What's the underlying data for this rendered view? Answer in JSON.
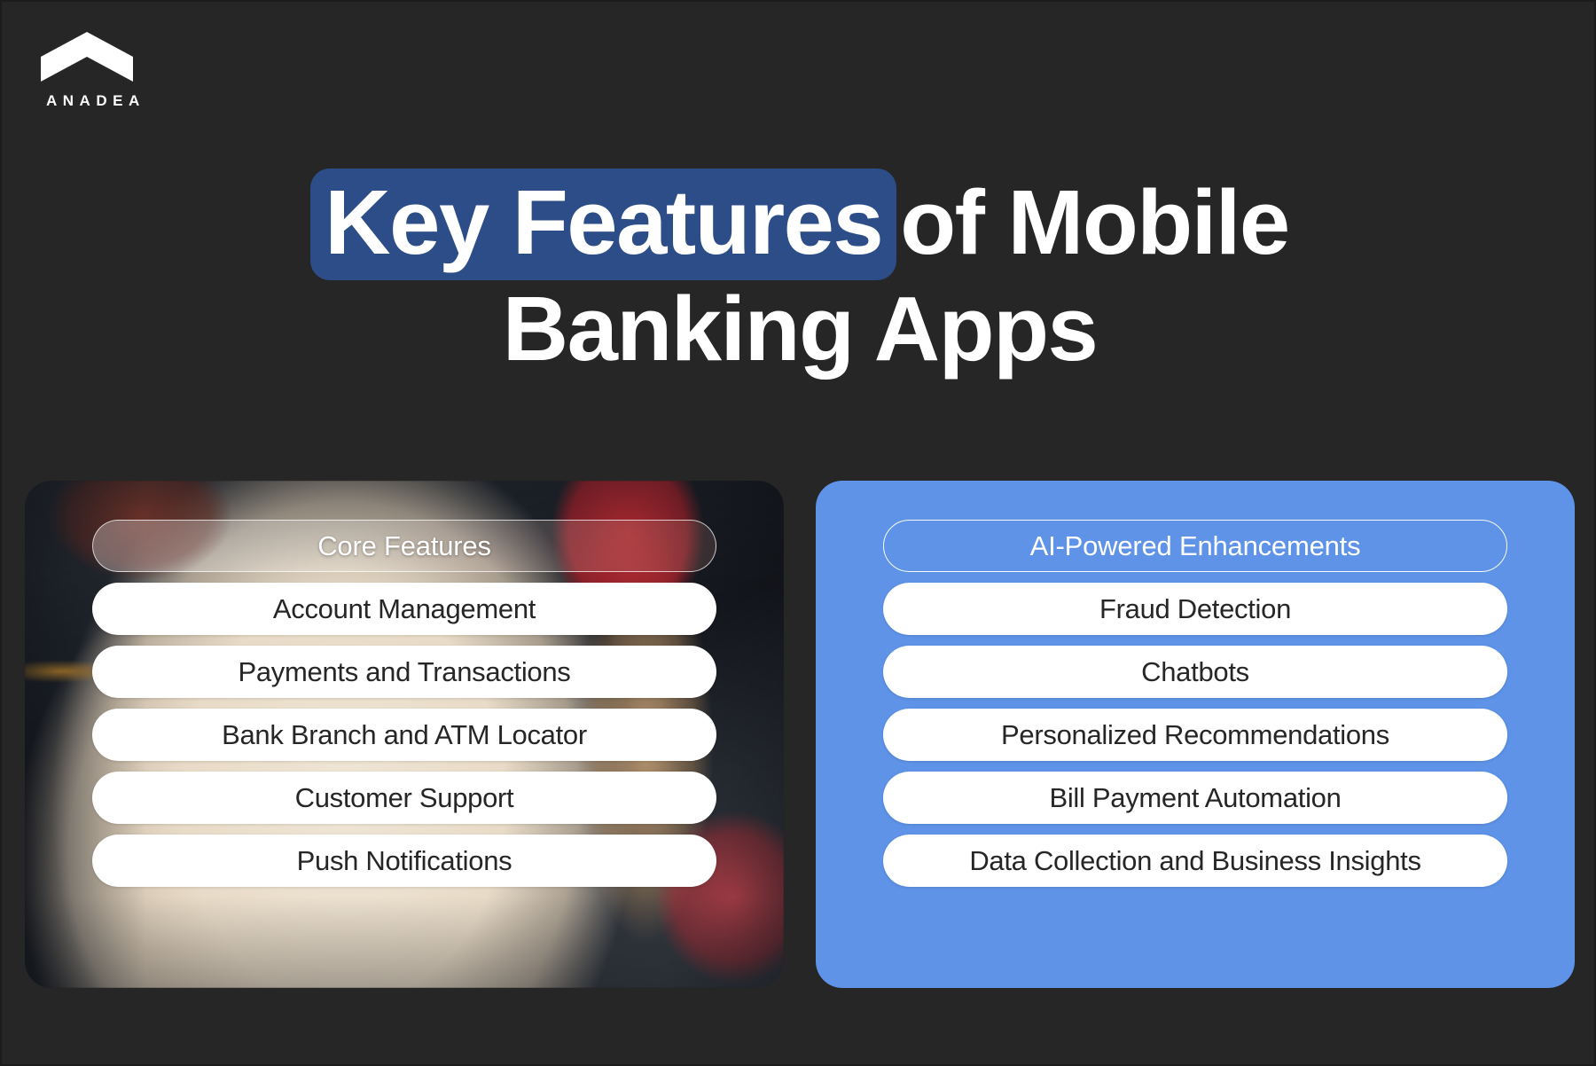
{
  "brand": {
    "name": "ANADEA",
    "logo_icon": "chevron-roof-logo"
  },
  "title": {
    "highlight": "Key Features",
    "rest_line1": "of Mobile",
    "line2": "Banking Apps"
  },
  "colors": {
    "page_background": "#262626",
    "title_highlight": "#2C4D87",
    "right_card": "#5E93E8",
    "pill_background": "#FFFFFF",
    "pill_text": "#262626"
  },
  "cards": [
    {
      "id": "core-features",
      "header": "Core Features",
      "items": [
        "Account Management",
        "Payments and Transactions",
        "Bank Branch and ATM Locator",
        "Customer Support",
        "Push Notifications"
      ]
    },
    {
      "id": "ai-powered-enhancements",
      "header": "AI-Powered Enhancements",
      "items": [
        "Fraud Detection",
        "Chatbots",
        "Personalized Recommendations",
        "Bill Payment Automation",
        "Data Collection and Business Insights"
      ]
    }
  ]
}
